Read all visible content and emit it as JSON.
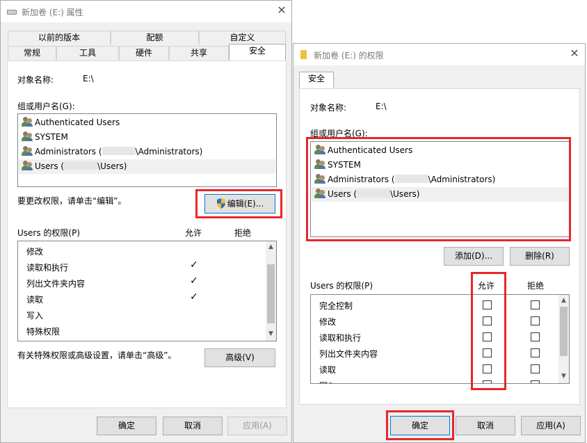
{
  "left_dialog": {
    "title": "新加卷 (E:) 属性",
    "tabs_row1": [
      "以前的版本",
      "配额",
      "自定义"
    ],
    "tabs_row2": [
      "常规",
      "工具",
      "硬件",
      "共享",
      "安全"
    ],
    "object_label": "对象名称:",
    "object_value": "E:\\",
    "group_label": "组或用户名(G):",
    "users": [
      {
        "pre": "Authenticated Users",
        "post": ""
      },
      {
        "pre": "SYSTEM",
        "post": ""
      },
      {
        "pre": "Administrators (",
        "post": "\\Administrators)"
      },
      {
        "pre": "Users (",
        "post": "\\Users)"
      }
    ],
    "change_hint": "要更改权限，请单击“编辑”。",
    "edit_button": "编辑(E)...",
    "perm_label": "Users 的权限(P)",
    "allow_header": "允许",
    "deny_header": "拒绝",
    "permissions": [
      "修改",
      "读取和执行",
      "列出文件夹内容",
      "读取",
      "写入",
      "特殊权限"
    ],
    "allow_checked": [
      false,
      true,
      true,
      true,
      false,
      false
    ],
    "adv_hint": "有关特殊权限或高级设置，请单击“高级”。",
    "advanced_button": "高级(V)",
    "ok_button": "确定",
    "cancel_button": "取消",
    "apply_button": "应用(A)"
  },
  "right_dialog": {
    "title": "新加卷 (E:) 的权限",
    "tab": "安全",
    "object_label": "对象名称:",
    "object_value": "E:\\",
    "group_label": "组或用户名(G):",
    "users": [
      {
        "pre": "Authenticated Users",
        "post": ""
      },
      {
        "pre": "SYSTEM",
        "post": ""
      },
      {
        "pre": "Administrators (",
        "post": "\\Administrators)"
      },
      {
        "pre": "Users (",
        "post": "\\Users)"
      }
    ],
    "add_button": "添加(D)...",
    "remove_button": "删除(R)",
    "perm_label": "Users 的权限(P)",
    "allow_header": "允许",
    "deny_header": "拒绝",
    "permissions": [
      "完全控制",
      "修改",
      "读取和执行",
      "列出文件夹内容",
      "读取",
      "写入"
    ],
    "ok_button": "确定",
    "cancel_button": "取消",
    "apply_button": "应用(A)"
  },
  "icons": {
    "close": "✕",
    "check": "✓",
    "scroll_up": "▲",
    "scroll_down": "▼"
  },
  "colors": {
    "highlight_red": "#e8262a",
    "dialog_bg": "#f0f0f0"
  }
}
